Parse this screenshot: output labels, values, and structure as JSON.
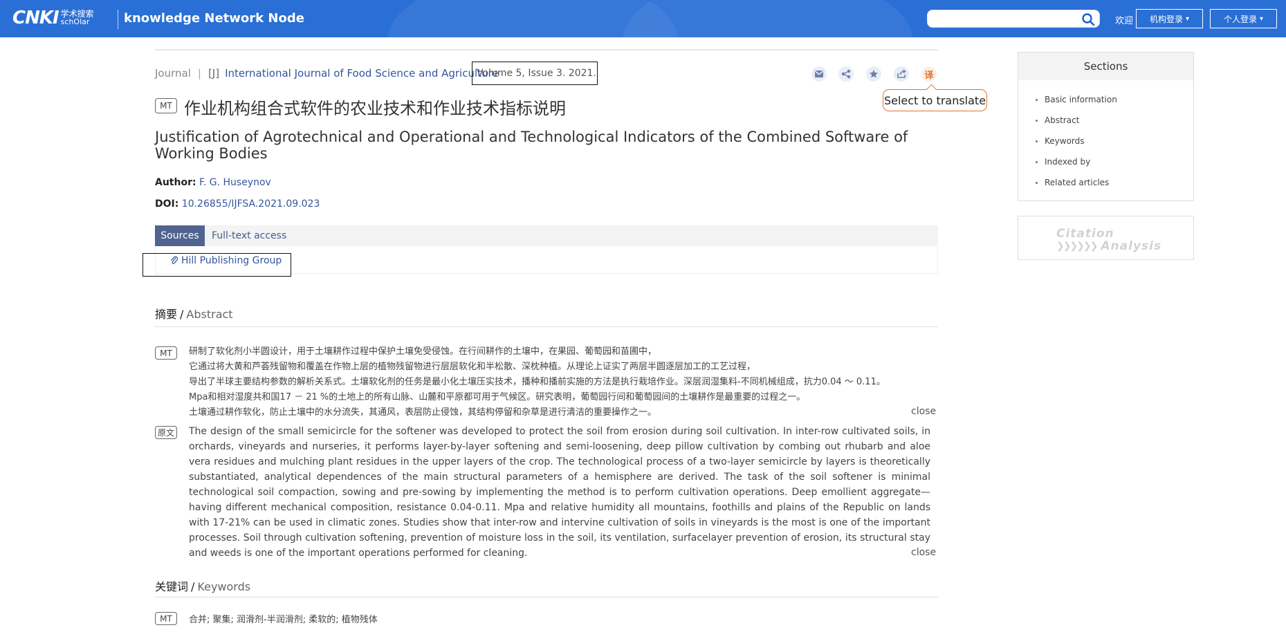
{
  "header": {
    "logo_main": "CNKI",
    "logo_cn": "学术搜索",
    "logo_en": "schOlar",
    "site_name": "knowledge Network Node",
    "search_value": "",
    "welcome": "欢迎",
    "org_login": "机构登录",
    "personal_login": "个人登录",
    "bg_color": "#2a6fd6"
  },
  "article": {
    "type_label": "Journal",
    "journal_tag": "[J]",
    "journal_name": "International Journal of Food Science and Agriculture",
    "volume": "Volume 5, Issue 3. 2021.",
    "translate_glyph": "译",
    "translate_tooltip": "Select to translate",
    "mt_badge": "MT",
    "title_cn": "作业机构组合式软件的农业技术和作业技术指标说明",
    "title_en": "Justification of Agrotechnical and Operational and Technological Indicators of the Combined Software of Working Bodies",
    "author_label": "Author:",
    "author": "F. G. Huseynov",
    "doi_label": "DOI:",
    "doi": "10.26855/IJFSA.2021.09.023"
  },
  "sources": {
    "tab_sources": "Sources",
    "tab_fulltext": "Full-text access",
    "publisher": "Hill Publishing Group"
  },
  "abstract": {
    "head_cn": "摘要",
    "slash": "/",
    "head_en": "Abstract",
    "mt_badge": "MT",
    "orig_badge": "原文",
    "cn_lines": [
      "研制了软化剂小半圆设计，用于土壤耕作过程中保护土壤免受侵蚀。在行间耕作的土壤中，在果园、葡萄园和苗圃中，",
      "它通过将大黄和芦荟残留物和覆盖在作物上层的植物残留物进行层层软化和半松散、深枕种植。从理论上证实了两层半圆逐层加工的工艺过程，",
      "导出了半球主要结构参数的解析关系式。土壤软化剂的任务是最小化土壤压实技术，播种和播前实施的方法是执行栽培作业。深层润湿集料-不同机械组成，抗力0.04 ～ 0.11。",
      "Mpa和相对湿度共和国17 － 21 %的土地上的所有山脉、山麓和平原都可用于气候区。研究表明，葡萄园行间和葡萄园间的土壤耕作是最重要的过程之一。",
      "土壤通过耕作软化，防止土壤中的水分流失，其通风，表层防止侵蚀，其结构停留和杂草是进行清洁的重要操作之一。"
    ],
    "close_label": "close",
    "en_text": "The design of the small semicircle for the softener was developed to protect the soil from erosion during soil cultivation. In inter-row cultivated soils, in orchards, vineyards and nurseries, it performs layer-by-layer softening and semi-loosening, deep pillow cultivation by combing out rhubarb and aloe vera residues and mulching plant residues in the upper layers of the crop. The technological process of a two-layer semicircle by layers is theoretically substantiated, analytical dependences of the main structural parameters of a hemisphere are derived. The task of the soil softener is minimal technological soil compaction, sowing and pre-sowing by implementing the method is to perform cultivation operations. Deep emollient aggregate—having different mechanical composition, resistance 0.04-0.11. Mpa and relative humidity all mountains, foothills and plains of the Republic on lands with 17-21% can be used in climatic zones. Studies show that inter-row and intervine cultivation of soils in vineyards is the most is one of the important processes. Soil through cultivation softening, prevention of moisture loss in the soil, its ventilation, surfacelayer prevention of erosion, its structural stay and weeds is one of the important operations performed for cleaning."
  },
  "keywords": {
    "head_cn": "关键词",
    "slash": "/",
    "head_en": "Keywords",
    "mt_badge": "MT",
    "text": "合并; 聚集; 润滑剂-半润滑剂; 柔软的; 植物残体"
  },
  "sidebar": {
    "sections_title": "Sections",
    "items": [
      "Basic information",
      "Abstract",
      "Keywords",
      "Indexed by",
      "Related articles"
    ],
    "citation_line1": "Citation",
    "citation_line2": "Analysis"
  },
  "icons": {
    "email": "mail-icon",
    "share": "share-icon",
    "favorite": "star-icon",
    "export": "export-icon",
    "translate": "translate-icon",
    "search": "search-icon",
    "attachment": "paperclip-icon"
  }
}
